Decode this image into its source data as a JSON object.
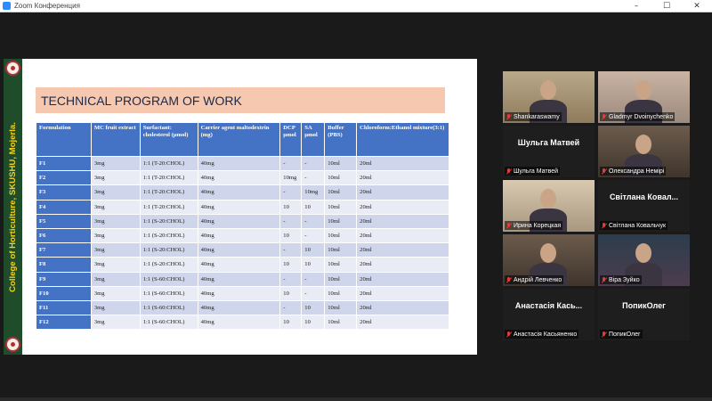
{
  "window": {
    "title": "Zoom Конференция",
    "controls": [
      "–",
      "☐",
      "✕"
    ]
  },
  "slide": {
    "sidebar_text": "College of Horticulture, SKUSHU, Mojerla.",
    "heading": "TECHNICAL PROGRAM OF WORK",
    "table": {
      "headers": [
        "Formulation",
        "MC fruit extract",
        "Surfactant: cholesterol (µmol)",
        "Carrier agent maltodextrin (mg)",
        "DCP µmol",
        "SA µmol",
        "Buffer (PBS)",
        "Chloroform:Ethanol mixture(3:1)"
      ],
      "rows": [
        [
          "F1",
          "3mg",
          "1:1 (T-20:CHOL)",
          "40mg",
          "-",
          "-",
          "10ml",
          "20ml"
        ],
        [
          "F2",
          "3mg",
          "1:1 (T-20:CHOL)",
          "40mg",
          "10mg",
          "-",
          "10ml",
          "20ml"
        ],
        [
          "F3",
          "3mg",
          "1:1 (T-20:CHOL)",
          "40mg",
          "-",
          "10mg",
          "10ml",
          "20ml"
        ],
        [
          "F4",
          "3mg",
          "1:1 (T-20:CHOL)",
          "40mg",
          "10",
          "10",
          "10ml",
          "20ml"
        ],
        [
          "F5",
          "3mg",
          "1:1 (S-20:CHOL)",
          "40mg",
          "-",
          "-",
          "10ml",
          "20ml"
        ],
        [
          "F6",
          "3mg",
          "1:1 (S-20:CHOL)",
          "40mg",
          "10",
          "-",
          "10ml",
          "20ml"
        ],
        [
          "F7",
          "3mg",
          "1:1 (S-20:CHOL)",
          "40mg",
          "-",
          "10",
          "10ml",
          "20ml"
        ],
        [
          "F8",
          "3mg",
          "1:1 (S-20:CHOL)",
          "40mg",
          "10",
          "10",
          "10ml",
          "20ml"
        ],
        [
          "F9",
          "3mg",
          "1:1 (S-60:CHOL)",
          "40mg",
          "-",
          "-",
          "10ml",
          "20ml"
        ],
        [
          "F10",
          "3mg",
          "1:1 (S-60:CHOL)",
          "40mg",
          "10",
          "-",
          "10ml",
          "20ml"
        ],
        [
          "F11",
          "3mg",
          "1:1 (S-60:CHOL)",
          "40mg",
          "-",
          "10",
          "10ml",
          "20ml"
        ],
        [
          "F12",
          "3mg",
          "1:1 (S-60:CHOL)",
          "40mg",
          "10",
          "10",
          "10ml",
          "20ml"
        ]
      ]
    }
  },
  "participants": [
    {
      "name": "Shankaraswamy",
      "big_name": "",
      "video": true,
      "style": "v1",
      "active": true
    },
    {
      "name": "Gladmyr Dvoinychenko",
      "big_name": "",
      "video": true,
      "style": "v2",
      "active": false
    },
    {
      "name": "Шульга Матвей",
      "big_name": "Шульга Матвей",
      "video": false,
      "style": "v5",
      "active": false
    },
    {
      "name": "Олександра Немірі",
      "big_name": "",
      "video": true,
      "style": "v3",
      "active": false
    },
    {
      "name": "Ирина Корецкая",
      "big_name": "",
      "video": true,
      "style": "v4",
      "active": false
    },
    {
      "name": "Світлана Ковальчук",
      "big_name": "Світлана Ковал...",
      "video": false,
      "style": "v5",
      "active": false
    },
    {
      "name": "Андрій Левченко",
      "big_name": "",
      "video": true,
      "style": "v3",
      "active": false
    },
    {
      "name": "Віра Зуйко",
      "big_name": "",
      "video": true,
      "style": "v6",
      "active": false
    },
    {
      "name": "Анастасія Касьяненко",
      "big_name": "Анастасія Кась...",
      "video": false,
      "style": "v5",
      "active": false
    },
    {
      "name": "ПопикОлег",
      "big_name": "ПопикОлег",
      "video": false,
      "style": "v5",
      "active": false
    }
  ],
  "colors": {
    "table_header": "#4472c4",
    "row_odd": "#cfd5ea",
    "row_even": "#e9ebf5",
    "heading_bg": "#f6c8b0",
    "sidebar_bg": "#1f4d2b",
    "sidebar_text": "#f2d21b",
    "active_speaker": "#d6e84a",
    "muted_mic": "#e23b3b"
  }
}
